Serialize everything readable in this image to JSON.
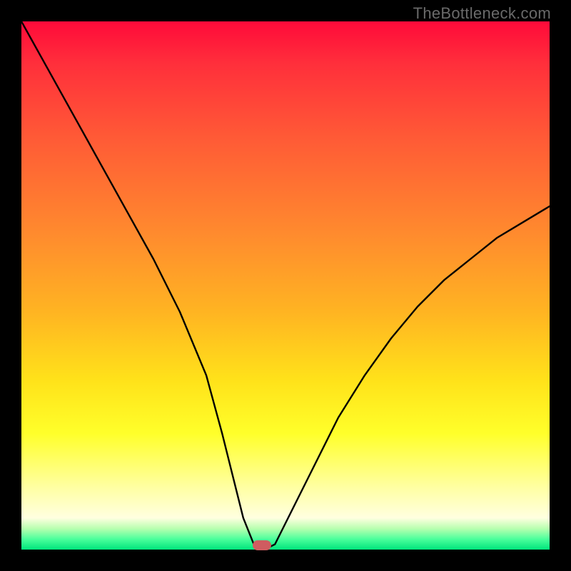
{
  "watermark": "TheBottleneck.com",
  "chart_data": {
    "type": "line",
    "title": "",
    "xlabel": "",
    "ylabel": "",
    "xlim": [
      0,
      100
    ],
    "ylim": [
      0,
      100
    ],
    "grid": false,
    "legend": false,
    "x": [
      0,
      5,
      10,
      15,
      20,
      25,
      30,
      35,
      38,
      40,
      42,
      44,
      45,
      46,
      48,
      50,
      55,
      60,
      65,
      70,
      75,
      80,
      85,
      90,
      95,
      100
    ],
    "values": [
      100,
      91,
      82,
      73,
      64,
      55,
      45,
      33,
      22,
      14,
      6,
      1,
      0,
      0,
      1,
      5,
      15,
      25,
      33,
      40,
      46,
      51,
      55,
      59,
      62,
      65
    ],
    "marker": {
      "x": 45.5,
      "y": 0
    },
    "colors": {
      "curve": "#000000",
      "marker": "#cf5c60",
      "gradient_top": "#ff0a3a",
      "gradient_bottom": "#00e57c"
    }
  }
}
